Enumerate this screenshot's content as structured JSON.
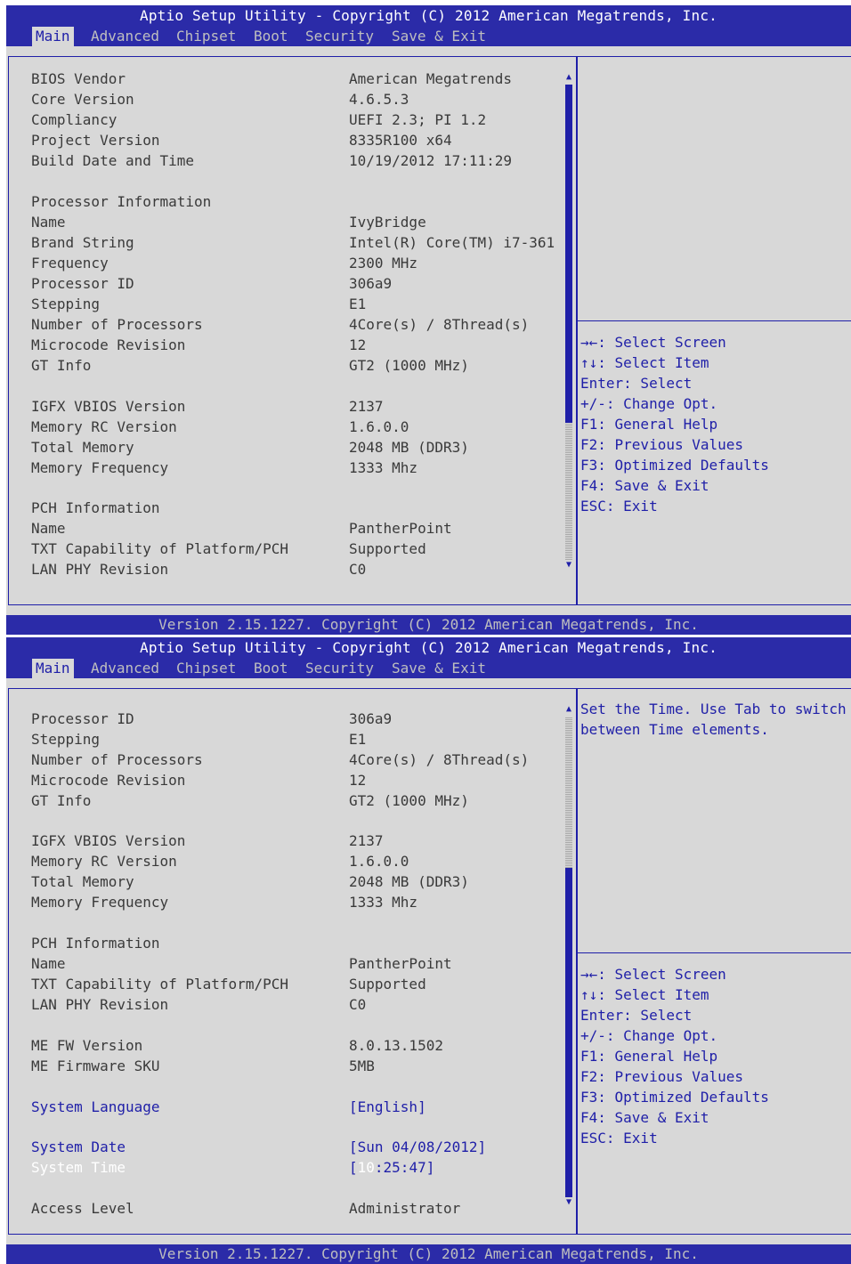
{
  "title": "Aptio Setup Utility - Copyright (C) 2012 American Megatrends, Inc.",
  "footer": "Version 2.15.1227. Copyright (C) 2012 American Megatrends, Inc.",
  "tabs": [
    "Main",
    "Advanced",
    "Chipset",
    "Boot",
    "Security",
    "Save & Exit"
  ],
  "active_tab": "Main",
  "keys": [
    "→←: Select Screen",
    "↑↓: Select Item",
    "Enter: Select",
    "+/-: Change Opt.",
    "F1: General Help",
    "F2: Previous Values",
    "F3: Optimized Defaults",
    "F4: Save & Exit",
    "ESC: Exit"
  ],
  "screen1": {
    "rows": [
      {
        "label": "BIOS Vendor",
        "value": "American Megatrends"
      },
      {
        "label": "Core Version",
        "value": "4.6.5.3"
      },
      {
        "label": "Compliancy",
        "value": "UEFI 2.3; PI 1.2"
      },
      {
        "label": "Project Version",
        "value": "8335R100 x64"
      },
      {
        "label": "Build Date and Time",
        "value": "10/19/2012 17:11:29"
      },
      {
        "label": "Processor Information",
        "value": ""
      },
      {
        "label": "Name",
        "value": "IvyBridge"
      },
      {
        "label": "Brand String",
        "value": "Intel(R) Core(TM) i7-361"
      },
      {
        "label": "Frequency",
        "value": "2300 MHz"
      },
      {
        "label": "Processor ID",
        "value": "306a9"
      },
      {
        "label": "Stepping",
        "value": "E1"
      },
      {
        "label": "Number of Processors",
        "value": "4Core(s) / 8Thread(s)"
      },
      {
        "label": "Microcode Revision",
        "value": "12"
      },
      {
        "label": "GT Info",
        "value": "GT2 (1000 MHz)"
      },
      {
        "label": "IGFX VBIOS Version",
        "value": "2137"
      },
      {
        "label": "Memory RC Version",
        "value": "1.6.0.0"
      },
      {
        "label": "Total Memory",
        "value": "2048 MB (DDR3)"
      },
      {
        "label": "Memory Frequency",
        "value": "1333 Mhz"
      },
      {
        "label": "PCH Information",
        "value": ""
      },
      {
        "label": "Name",
        "value": "PantherPoint"
      },
      {
        "label": "TXT Capability of Platform/PCH",
        "value": "Supported"
      },
      {
        "label": "LAN PHY Revision",
        "value": "C0"
      }
    ],
    "help_text": ""
  },
  "screen2": {
    "rows": [
      {
        "label": "Processor ID",
        "value": "306a9"
      },
      {
        "label": "Stepping",
        "value": "E1"
      },
      {
        "label": "Number of Processors",
        "value": "4Core(s) / 8Thread(s)"
      },
      {
        "label": "Microcode Revision",
        "value": "12"
      },
      {
        "label": "GT Info",
        "value": "GT2 (1000 MHz)"
      },
      {
        "label": "IGFX VBIOS Version",
        "value": "2137"
      },
      {
        "label": "Memory RC Version",
        "value": "1.6.0.0"
      },
      {
        "label": "Total Memory",
        "value": "2048 MB (DDR3)"
      },
      {
        "label": "Memory Frequency",
        "value": "1333 Mhz"
      },
      {
        "label": "PCH Information",
        "value": ""
      },
      {
        "label": "Name",
        "value": "PantherPoint"
      },
      {
        "label": "TXT Capability of Platform/PCH",
        "value": "Supported"
      },
      {
        "label": "LAN PHY Revision",
        "value": "C0"
      },
      {
        "label": "ME FW Version",
        "value": "8.0.13.1502"
      },
      {
        "label": "ME Firmware SKU",
        "value": "5MB"
      },
      {
        "label": "System Language",
        "value": "[English]"
      },
      {
        "label": "System Date",
        "value": "[Sun 04/08/2012]"
      },
      {
        "label": "System Time",
        "value_prefix": "[",
        "value_highlight": "10",
        "value_rest": ":25:47]"
      },
      {
        "label": "Access Level",
        "value": "Administrator"
      }
    ],
    "help_text": "Set the Time. Use Tab to switch between Time elements."
  }
}
